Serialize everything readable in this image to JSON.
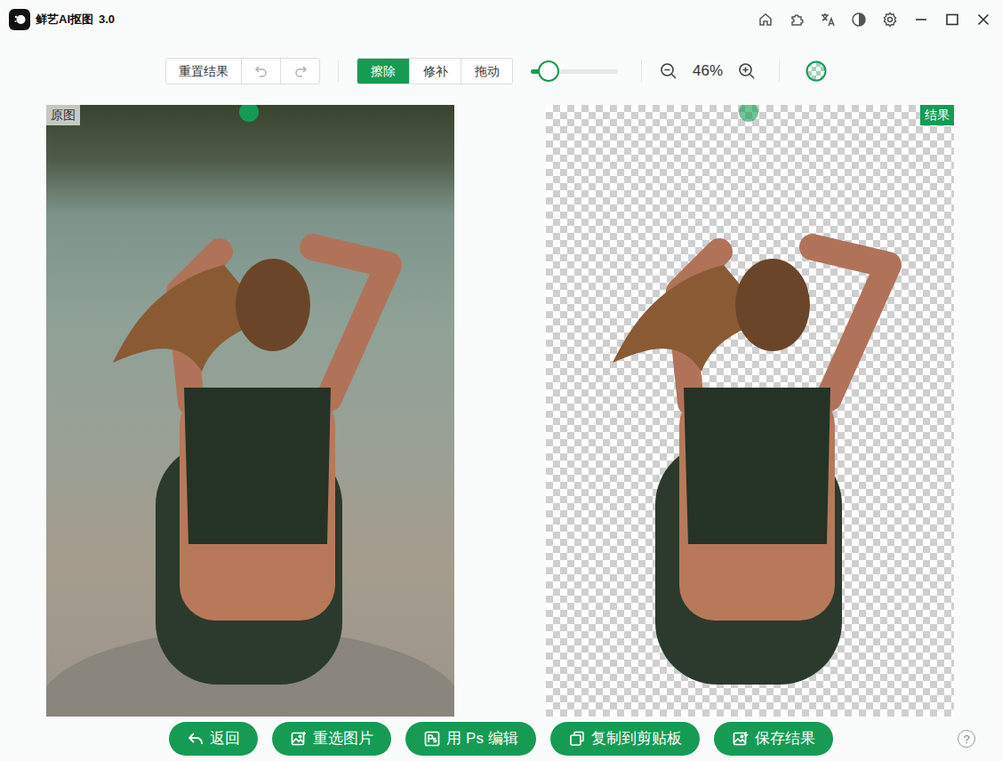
{
  "window": {
    "title": "鲜艺AI抠图",
    "version": "3.0"
  },
  "toolbar": {
    "reset": "重置结果",
    "undo": {
      "disabled": true
    },
    "redo": {
      "disabled": true
    },
    "modes": [
      {
        "label": "擦除",
        "selected": true
      },
      {
        "label": "修补",
        "selected": false
      },
      {
        "label": "拖动",
        "selected": false
      }
    ],
    "brush_size": {
      "level": 0.2
    },
    "zoom": "46%"
  },
  "panels": {
    "original": {
      "label": "原图"
    },
    "result": {
      "label": "结果"
    }
  },
  "buttons": [
    {
      "label": "返回"
    },
    {
      "label": "重选图片"
    },
    {
      "label": "用 Ps 编辑"
    },
    {
      "label": "复制到剪贴板"
    },
    {
      "label": "保存结果"
    }
  ],
  "help": "?"
}
